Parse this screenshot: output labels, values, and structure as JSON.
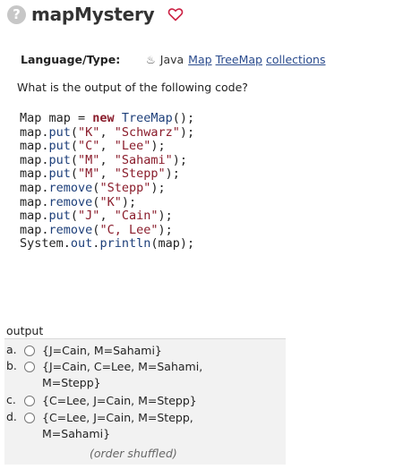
{
  "header": {
    "help_icon_glyph": "?",
    "title": "mapMystery",
    "heart_icon": "heart-outline-icon",
    "heart_color": "#cc2244"
  },
  "language": {
    "label": "Language/Type:",
    "java_icon": "java-cup-icon",
    "java_text": "Java",
    "tags": [
      "Map",
      "TreeMap",
      "collections"
    ]
  },
  "question": "What is the output of the following code?",
  "code_lines": [
    "Map map = new TreeMap();",
    "map.put(\"K\", \"Schwarz\");",
    "map.put(\"C\", \"Lee\");",
    "map.put(\"M\", \"Sahami\");",
    "map.put(\"M\", \"Stepp\");",
    "map.remove(\"Stepp\");",
    "map.remove(\"K\");",
    "map.put(\"J\", \"Cain\");",
    "map.remove(\"C, Lee\");",
    "System.out.println(map);"
  ],
  "output": {
    "label": "output",
    "options": [
      {
        "letter": "a.",
        "text": "{J=Cain, M=Sahami}"
      },
      {
        "letter": "b.",
        "text": "{J=Cain, C=Lee, M=Sahami,\nM=Stepp}"
      },
      {
        "letter": "c.",
        "text": "{C=Lee, J=Cain, M=Stepp}"
      },
      {
        "letter": "d.",
        "text": "{C=Lee, J=Cain, M=Stepp,\nM=Sahami}"
      }
    ],
    "shuffled_note": "(order shuffled)"
  }
}
